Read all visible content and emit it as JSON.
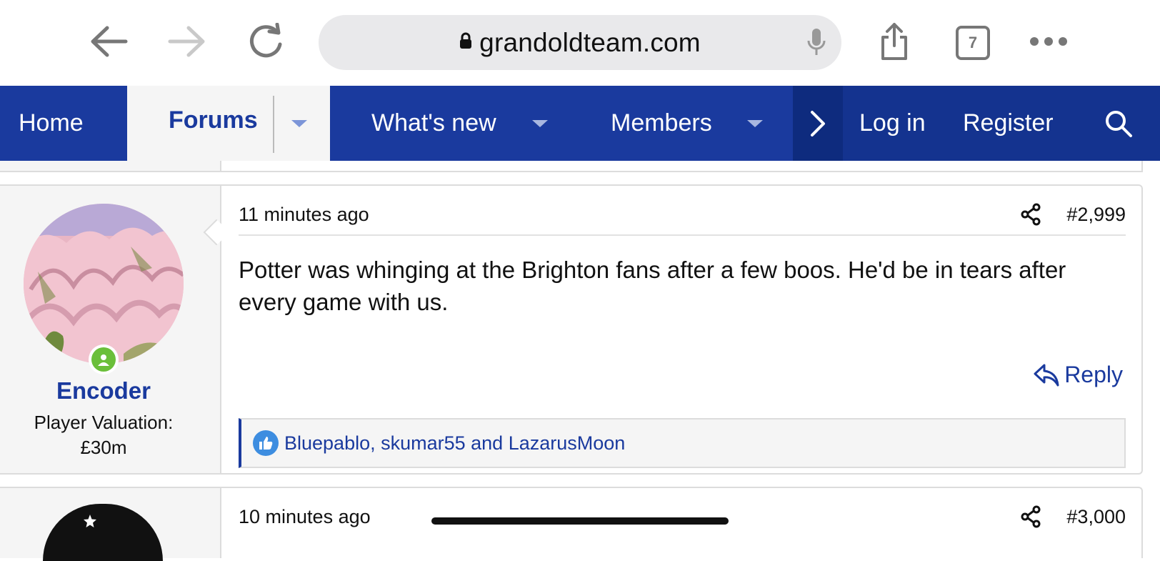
{
  "browser": {
    "url": "grandoldteam.com",
    "tab_count": "7"
  },
  "nav": {
    "home": "Home",
    "forums": "Forums",
    "whats_new": "What's new",
    "members": "Members",
    "login": "Log in",
    "register": "Register"
  },
  "posts": [
    {
      "time": "11 minutes ago",
      "number": "#2,999",
      "username": "Encoder",
      "user_title_1": "Player Valuation:",
      "user_title_2": "£30m",
      "body": "Potter was whinging at the Brighton fans after a few boos. He'd be in tears after every game with us.",
      "reply": "Reply",
      "reactions": "Bluepablo, skumar55 and LazarusMoon"
    },
    {
      "time": "10 minutes ago",
      "number": "#3,000"
    }
  ],
  "colors": {
    "brand": "#1a3a9e",
    "online": "#6bbf3a",
    "like": "#3d8de0"
  }
}
